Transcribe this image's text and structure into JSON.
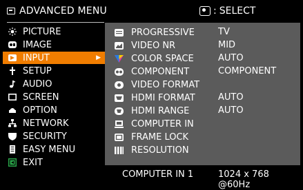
{
  "header": {
    "title": "ADVANCED MENU",
    "select_label": "SELECT"
  },
  "left_menu": [
    {
      "label": "PICTURE",
      "icon": "picture-icon"
    },
    {
      "label": "IMAGE",
      "icon": "image-icon"
    },
    {
      "label": "INPUT",
      "icon": "input-icon",
      "active": true
    },
    {
      "label": "SETUP",
      "icon": "setup-icon"
    },
    {
      "label": "AUDIO",
      "icon": "audio-icon"
    },
    {
      "label": "SCREEN",
      "icon": "screen-icon"
    },
    {
      "label": "OPTION",
      "icon": "option-icon"
    },
    {
      "label": "NETWORK",
      "icon": "network-icon"
    },
    {
      "label": "SECURITY",
      "icon": "security-icon"
    },
    {
      "label": "EASY MENU",
      "icon": "easy-menu-icon"
    },
    {
      "label": "EXIT",
      "icon": "exit-icon"
    }
  ],
  "input_menu": [
    {
      "label": "PROGRESSIVE",
      "value": "TV",
      "icon": "progressive-icon"
    },
    {
      "label": "VIDEO NR",
      "value": "MID",
      "icon": "video-nr-icon"
    },
    {
      "label": "COLOR SPACE",
      "value": "AUTO",
      "icon": "color-space-icon"
    },
    {
      "label": "COMPONENT",
      "value": "COMPONENT",
      "icon": "component-icon"
    },
    {
      "label": "VIDEO FORMAT",
      "value": "",
      "icon": "video-format-icon"
    },
    {
      "label": "HDMI FORMAT",
      "value": "AUTO",
      "icon": "hdmi-format-icon"
    },
    {
      "label": "HDMI RANGE",
      "value": "AUTO",
      "icon": "hdmi-range-icon"
    },
    {
      "label": "COMPUTER IN",
      "value": "",
      "icon": "computer-in-icon"
    },
    {
      "label": "FRAME LOCK",
      "value": "",
      "icon": "frame-lock-icon"
    },
    {
      "label": "RESOLUTION",
      "value": "",
      "icon": "resolution-icon"
    }
  ],
  "footer": {
    "source": "COMPUTER IN 1",
    "resolution": "1024 x 768 @60Hz"
  },
  "colors": {
    "active": "#f07d00",
    "panel": "#5b5b5b",
    "background": "#000000"
  }
}
